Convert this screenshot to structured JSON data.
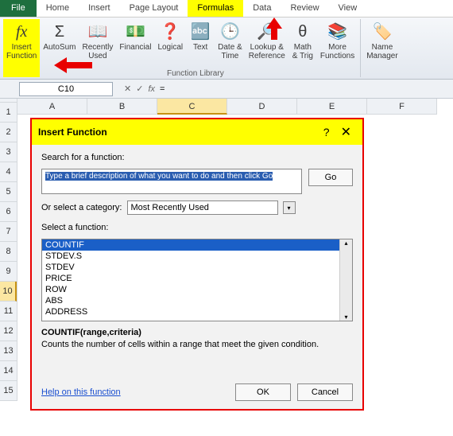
{
  "tabs": {
    "file": "File",
    "home": "Home",
    "insert": "Insert",
    "page_layout": "Page Layout",
    "formulas": "Formulas",
    "data": "Data",
    "review": "Review",
    "view": "View"
  },
  "ribbon": {
    "insert_function": "Insert\nFunction",
    "autosum": "AutoSum",
    "recently_used": "Recently\nUsed",
    "financial": "Financial",
    "logical": "Logical",
    "text": "Text",
    "date_time": "Date &\nTime",
    "lookup_ref": "Lookup &\nReference",
    "math_trig": "Math\n& Trig",
    "more_functions": "More\nFunctions",
    "name_manager": "Name\nManager",
    "group_label": "Function Library"
  },
  "namebox": "C10",
  "fx_icons": {
    "cancel": "✕",
    "enter": "✓",
    "fx": "fx"
  },
  "formula_bar": "=",
  "columns": [
    "A",
    "B",
    "C",
    "D",
    "E",
    "F"
  ],
  "rows": [
    "1",
    "2",
    "3",
    "4",
    "5",
    "6",
    "7",
    "8",
    "9",
    "10",
    "11",
    "12",
    "13",
    "14",
    "15"
  ],
  "selected_row": "10",
  "selected_col": "C",
  "dialog": {
    "title": "Insert Function",
    "help_icon": "?",
    "close_icon": "✕",
    "search_label": "Search for a function:",
    "search_text": "Type a brief description of what you want to do and then click Go",
    "go": "Go",
    "category_label": "Or select a category:",
    "category_value": "Most Recently Used",
    "select_label": "Select a function:",
    "functions": [
      "COUNTIF",
      "STDEV.S",
      "STDEV",
      "PRICE",
      "ROW",
      "ABS",
      "ADDRESS"
    ],
    "signature": "COUNTIF(range,criteria)",
    "description": "Counts the number of cells within a range that meet the given condition.",
    "help_link": "Help on this function",
    "ok": "OK",
    "cancel": "Cancel"
  }
}
